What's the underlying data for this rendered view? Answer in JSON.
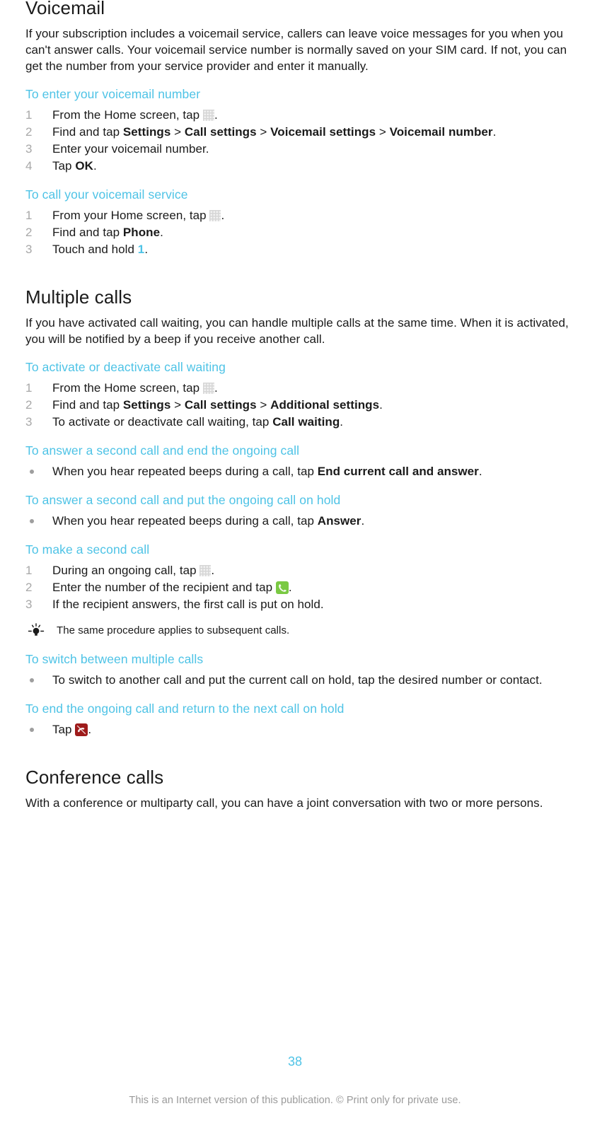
{
  "document": {
    "page_number": "38",
    "footer_note": "This is an Internet version of this publication. © Print only for private use.",
    "accent_color": "#4ec3e6",
    "marker_color": "#a8a8a8"
  },
  "sections": [
    {
      "title": "Voicemail",
      "intro": "If your subscription includes a voicemail service, callers can leave voice messages for you when you can't answer calls. Your voicemail service number is normally saved on your SIM card. If not, you can get the number from your service provider and enter it manually.",
      "procedures": [
        {
          "title": "To enter your voicemail number",
          "type": "ordered",
          "steps": [
            {
              "number": "1",
              "pre": "From the Home screen, tap ",
              "icon": "home-grid-icon",
              "post": "."
            },
            {
              "number": "2",
              "pre": "Find and tap ",
              "bold1": "Settings",
              "sep1": " > ",
              "bold2": "Call settings",
              "sep2": " > ",
              "bold3": "Voicemail settings",
              "sep3": " > ",
              "bold4": "Voicemail number",
              "post": "."
            },
            {
              "number": "3",
              "pre": "Enter your voicemail number.",
              "post": ""
            },
            {
              "number": "4",
              "pre": "Tap ",
              "bold1": "OK",
              "post": "."
            }
          ]
        },
        {
          "title": "To call your voicemail service",
          "type": "ordered",
          "steps": [
            {
              "number": "1",
              "pre": "From your Home screen, tap ",
              "icon": "home-grid-icon",
              "post": "."
            },
            {
              "number": "2",
              "pre": "Find and tap ",
              "bold1": "Phone",
              "post": "."
            },
            {
              "number": "3",
              "pre": "Touch and hold ",
              "cyan": "1",
              "post": "."
            }
          ]
        }
      ]
    },
    {
      "title": "Multiple calls",
      "intro": "If you have activated call waiting, you can handle multiple calls at the same time. When it is activated, you will be notified by a beep if you receive another call.",
      "procedures": [
        {
          "title": "To activate or deactivate call waiting",
          "type": "ordered",
          "steps": [
            {
              "number": "1",
              "pre": "From the Home screen, tap ",
              "icon": "home-grid-icon",
              "post": "."
            },
            {
              "number": "2",
              "pre": "Find and tap ",
              "bold1": "Settings",
              "sep1": " > ",
              "bold2": "Call settings",
              "sep2": " > ",
              "bold3": "Additional settings",
              "post": "."
            },
            {
              "number": "3",
              "pre": "To activate or deactivate call waiting, tap ",
              "bold1": "Call waiting",
              "post": "."
            }
          ]
        },
        {
          "title": "To answer a second call and end the ongoing call",
          "type": "bulleted",
          "steps": [
            {
              "pre": "When you hear repeated beeps during a call, tap ",
              "bold1": "End current call and answer",
              "post": "."
            }
          ]
        },
        {
          "title": "To answer a second call and put the ongoing call on hold",
          "type": "bulleted",
          "steps": [
            {
              "pre": "When you hear repeated beeps during a call, tap ",
              "bold1": "Answer",
              "post": "."
            }
          ]
        },
        {
          "title": "To make a second call",
          "type": "ordered",
          "steps": [
            {
              "number": "1",
              "pre": "During an ongoing call, tap ",
              "icon": "home-grid-icon",
              "post": "."
            },
            {
              "number": "2",
              "pre": "Enter the number of the recipient and tap ",
              "icon": "green-call-icon",
              "post": "."
            },
            {
              "number": "3",
              "pre": "If the recipient answers, the first call is put on hold.",
              "post": ""
            }
          ],
          "tip": "The same procedure applies to subsequent calls."
        },
        {
          "title": "To switch between multiple calls",
          "type": "bulleted",
          "steps": [
            {
              "pre": "To switch to another call and put the current call on hold, tap the desired number or contact.",
              "post": ""
            }
          ]
        },
        {
          "title": "To end the ongoing call and return to the next call on hold",
          "type": "bulleted",
          "steps": [
            {
              "pre": "Tap ",
              "icon": "red-end-call-icon",
              "post": "."
            }
          ]
        }
      ]
    },
    {
      "title": "Conference calls",
      "intro": "With a conference or multiparty call, you can have a joint conversation with two or more persons.",
      "procedures": []
    }
  ]
}
